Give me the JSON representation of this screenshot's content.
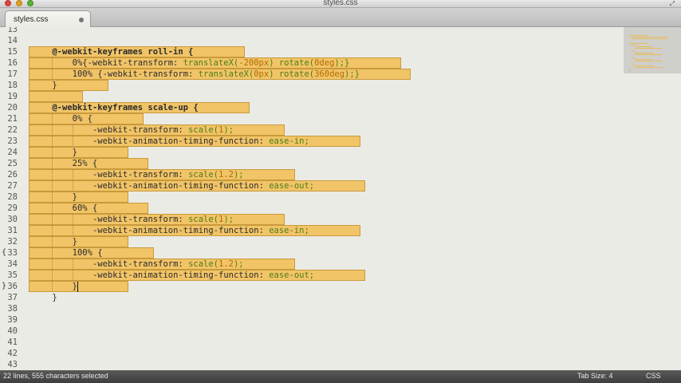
{
  "window": {
    "title": "styles.css"
  },
  "tab": {
    "label": "styles.css"
  },
  "status": {
    "selection": "22 lines, 555 characters selected",
    "tab_size": "Tab Size: 4",
    "syntax": "CSS"
  },
  "gutter": {
    "line_numbers": [
      "13",
      "14",
      "15",
      "16",
      "17",
      "18",
      "19",
      "20",
      "21",
      "22",
      "23",
      "24",
      "25",
      "26",
      "27",
      "28",
      "29",
      "30",
      "31",
      "32",
      "33",
      "34",
      "35",
      "36",
      "37",
      "38",
      "39",
      "40",
      "41",
      "42",
      "43"
    ]
  },
  "code": {
    "lines": [
      [],
      [],
      [
        {
          "t": "@-webkit-keyframes roll-in {",
          "c": "at"
        }
      ],
      [
        {
          "t": "0%{-webkit-transform: ",
          "c": "prop"
        },
        {
          "t": "translateX(",
          "c": "fn"
        },
        {
          "t": "-200px",
          "c": "num"
        },
        {
          "t": ") ",
          "c": "fn"
        },
        {
          "t": "rotate(",
          "c": "fn"
        },
        {
          "t": "0deg",
          "c": "num"
        },
        {
          "t": ");}",
          "c": "fn"
        }
      ],
      [
        {
          "t": "100% {-webkit-transform: ",
          "c": "prop"
        },
        {
          "t": "translateX(",
          "c": "fn"
        },
        {
          "t": "0px",
          "c": "num"
        },
        {
          "t": ") ",
          "c": "fn"
        },
        {
          "t": "rotate(",
          "c": "fn"
        },
        {
          "t": "360deg",
          "c": "num"
        },
        {
          "t": ");}",
          "c": "fn"
        }
      ],
      [
        {
          "t": "}",
          "c": "prop"
        }
      ],
      [],
      [
        {
          "t": "@-webkit-keyframes scale-up {",
          "c": "at"
        }
      ],
      [
        {
          "t": "0% {",
          "c": "prop"
        }
      ],
      [
        {
          "t": "-webkit-transform: ",
          "c": "prop"
        },
        {
          "t": "scale(",
          "c": "fn"
        },
        {
          "t": "1",
          "c": "num"
        },
        {
          "t": ");",
          "c": "fn"
        }
      ],
      [
        {
          "t": "-webkit-animation-timing-function: ",
          "c": "prop"
        },
        {
          "t": "ease-in;",
          "c": "kw"
        }
      ],
      [
        {
          "t": "}",
          "c": "prop"
        }
      ],
      [
        {
          "t": "25% {",
          "c": "prop"
        }
      ],
      [
        {
          "t": "-webkit-transform: ",
          "c": "prop"
        },
        {
          "t": "scale(",
          "c": "fn"
        },
        {
          "t": "1.2",
          "c": "num"
        },
        {
          "t": ");",
          "c": "fn"
        }
      ],
      [
        {
          "t": "-webkit-animation-timing-function: ",
          "c": "prop"
        },
        {
          "t": "ease-out;",
          "c": "kw"
        }
      ],
      [
        {
          "t": "}",
          "c": "prop"
        }
      ],
      [
        {
          "t": "60% {",
          "c": "prop"
        }
      ],
      [
        {
          "t": "-webkit-transform: ",
          "c": "prop"
        },
        {
          "t": "scale(",
          "c": "fn"
        },
        {
          "t": "1",
          "c": "num"
        },
        {
          "t": ");",
          "c": "fn"
        }
      ],
      [
        {
          "t": "-webkit-animation-timing-function: ",
          "c": "prop"
        },
        {
          "t": "ease-in;",
          "c": "kw"
        }
      ],
      [
        {
          "t": "}",
          "c": "prop"
        }
      ],
      [
        {
          "t": "100% {",
          "c": "prop"
        }
      ],
      [
        {
          "t": "-webkit-transform: ",
          "c": "prop"
        },
        {
          "t": "scale(",
          "c": "fn"
        },
        {
          "t": "1.2",
          "c": "num"
        },
        {
          "t": ");",
          "c": "fn"
        }
      ],
      [
        {
          "t": "-webkit-animation-timing-function: ",
          "c": "prop"
        },
        {
          "t": "ease-out;",
          "c": "kw"
        }
      ],
      [
        {
          "t": "}",
          "c": "prop"
        }
      ],
      [
        {
          "t": "}",
          "c": "prop"
        }
      ],
      [],
      [],
      [],
      [],
      [],
      []
    ]
  },
  "colors": {
    "selection": "#f1c467",
    "background": "#ebebe6"
  }
}
